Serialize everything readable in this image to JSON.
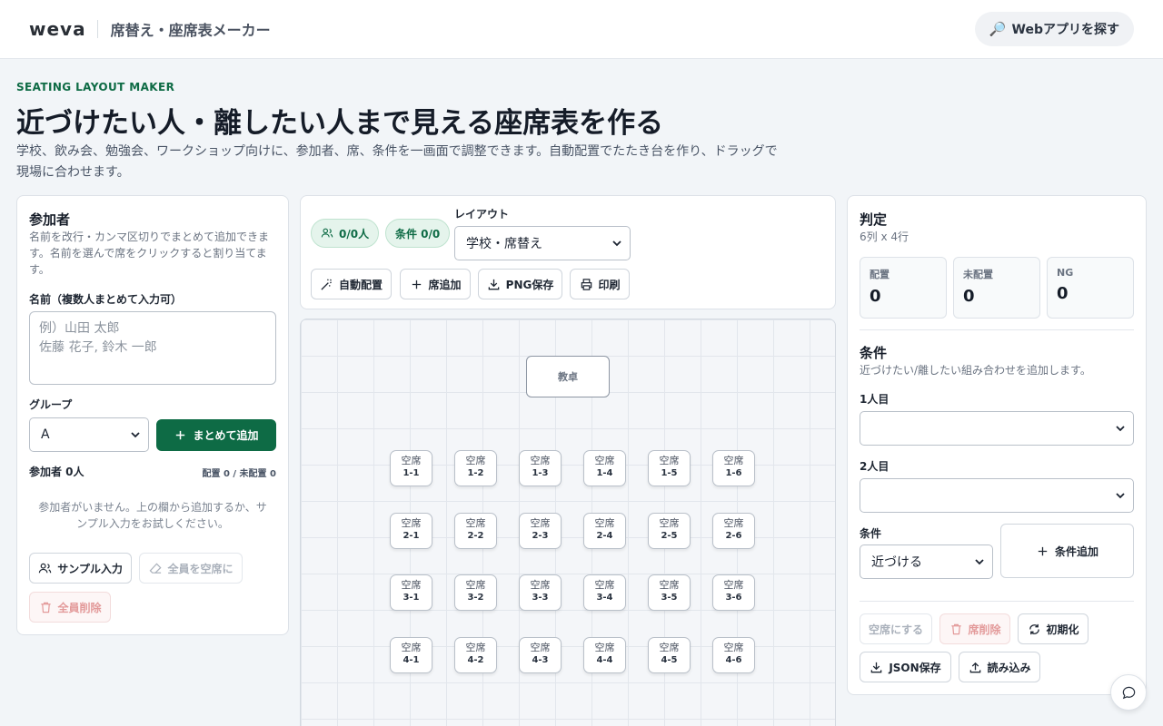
{
  "header": {
    "logo": "weva",
    "app_name": "席替え・座席表メーカー",
    "find_apps": "Webアプリを探す"
  },
  "hero": {
    "eyebrow": "SEATING LAYOUT MAKER",
    "title": "近づけたい人・離したい人まで見える座席表を作る",
    "lead": "学校、飲み会、勉強会、ワークショップ向けに、参加者、席、条件を一画面で調整できます。自動配置でたたき台を作り、ドラッグで現場に合わせます。"
  },
  "participants": {
    "title": "参加者",
    "description": "名前を改行・カンマ区切りでまとめて追加できます。名前を選んで席をクリックすると割り当てます。",
    "name_label": "名前（複数人まとめて入力可）",
    "name_placeholder": "例）山田 太郎\n佐藤 花子, 鈴木 一郎",
    "group_label": "グループ",
    "group_value": "A",
    "add_bulk": "まとめて追加",
    "count_label": "参加者 0人",
    "placed_status": "配置 0 / 未配置 0",
    "empty_message": "参加者がいません。上の欄から追加するか、サンプル入力をお試しください。",
    "sample_input": "サンプル入力",
    "vacate_all": "全員を空席に",
    "delete_all": "全員削除"
  },
  "toolbar": {
    "people_pill": "0/0人",
    "cond_pill": "条件 0/0",
    "layout_label": "レイアウト",
    "layout_value": "学校・席替え",
    "auto_place": "自動配置",
    "add_seat": "席追加",
    "png_save": "PNG保存",
    "print": "印刷"
  },
  "canvas": {
    "podium": "教卓",
    "seat_label": "空席",
    "rows": [
      [
        "1-1",
        "1-2",
        "1-3",
        "1-4",
        "1-5",
        "1-6"
      ],
      [
        "2-1",
        "2-2",
        "2-3",
        "2-4",
        "2-5",
        "2-6"
      ],
      [
        "3-1",
        "3-2",
        "3-3",
        "3-4",
        "3-5",
        "3-6"
      ],
      [
        "4-1",
        "4-2",
        "4-3",
        "4-4",
        "4-5",
        "4-6"
      ]
    ]
  },
  "judge": {
    "title": "判定",
    "grid_size": "6列 x 4行",
    "stats": [
      {
        "key": "配置",
        "value": "0"
      },
      {
        "key": "未配置",
        "value": "0"
      },
      {
        "key": "NG",
        "value": "0"
      }
    ],
    "cond_title": "条件",
    "cond_desc": "近づけたい/離したい組み合わせを追加します。",
    "person1_label": "1人目",
    "person2_label": "2人目",
    "cond_label": "条件",
    "cond_value": "近づける",
    "add_cond": "条件追加",
    "vacate": "空席にする",
    "delete_seat": "席削除",
    "reset": "初期化",
    "json_save": "JSON保存",
    "load": "読み込み"
  },
  "colors": {
    "brand_green": "#0e6b45",
    "pill_bg": "#e5f4ec",
    "danger_text": "#e39a9a"
  }
}
